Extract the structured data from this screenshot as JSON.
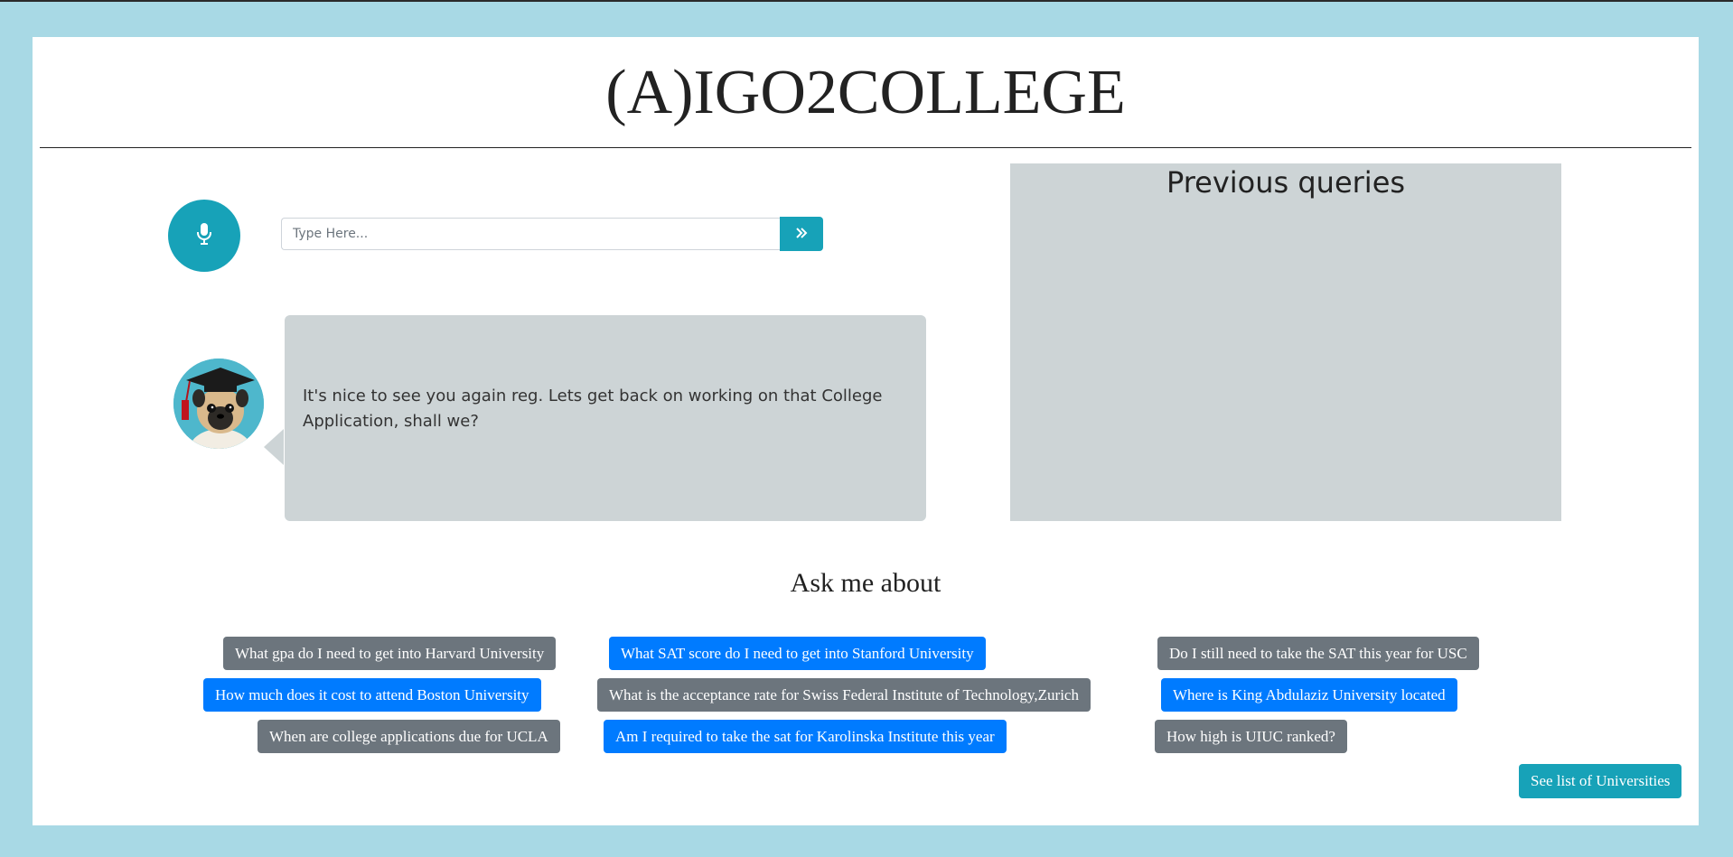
{
  "header": {
    "title": "(A)IGO2COLLEGE"
  },
  "search": {
    "placeholder": "Type Here...",
    "value": ""
  },
  "chat": {
    "message": "It's nice to see you again reg. Lets get back on working on that College Application, shall we?"
  },
  "previous_queries": {
    "title": "Previous queries"
  },
  "ask": {
    "title": "Ask me about",
    "suggestions": [
      "What gpa do I need to get into Harvard University",
      "What SAT score do I need to get into Stanford University",
      "Do I still need to take the SAT this year for USC",
      "How much does it cost to attend Boston University",
      "What is the acceptance rate for Swiss Federal Institute of Technology,Zurich",
      "Where is King Abdulaziz University located",
      "When are college applications due for UCLA",
      "Am I required to take the sat for Karolinska Institute this year",
      "How high is UIUC ranked?"
    ]
  },
  "footer": {
    "universities_button": "See list of Universities"
  },
  "colors": {
    "background": "#a8d9e5",
    "accent": "#17a2b8",
    "chip_gray": "#6c757d",
    "chip_blue": "#007bff",
    "panel": "#cdd4d6"
  },
  "icons": {
    "mic": "microphone-icon",
    "send": "double-chevron-right-icon",
    "avatar": "pug-graduate-avatar"
  }
}
